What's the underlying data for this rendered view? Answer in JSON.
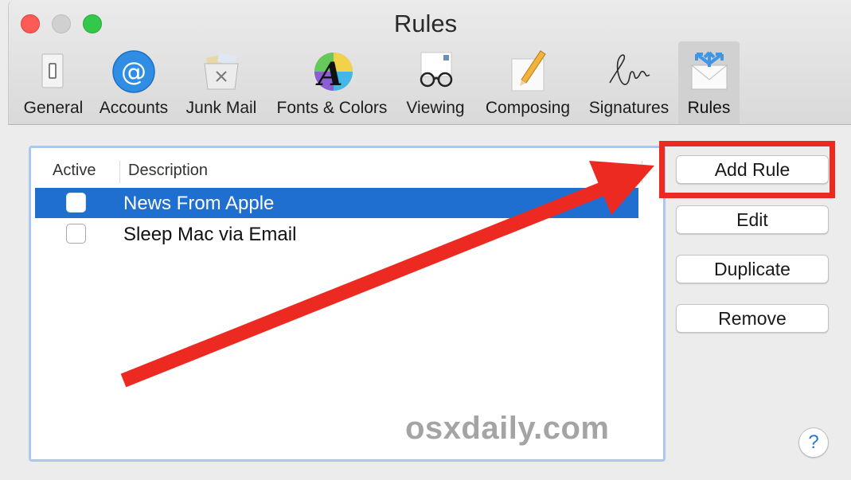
{
  "window": {
    "title": "Rules"
  },
  "toolbar": {
    "tabs": [
      {
        "label": "General",
        "icon": "general-switch-icon"
      },
      {
        "label": "Accounts",
        "icon": "at-sign-icon"
      },
      {
        "label": "Junk Mail",
        "icon": "junk-trash-icon"
      },
      {
        "label": "Fonts & Colors",
        "icon": "font-color-wheel-icon"
      },
      {
        "label": "Viewing",
        "icon": "glasses-envelope-icon"
      },
      {
        "label": "Composing",
        "icon": "pencil-paper-icon"
      },
      {
        "label": "Signatures",
        "icon": "signature-icon"
      },
      {
        "label": "Rules",
        "icon": "rules-envelope-arrows-icon"
      }
    ],
    "selected_tab": "Rules"
  },
  "rules_list": {
    "columns": {
      "active": "Active",
      "description": "Description"
    },
    "rows": [
      {
        "active": false,
        "description": "News From Apple",
        "selected": true
      },
      {
        "active": false,
        "description": "Sleep Mac via Email",
        "selected": false
      }
    ]
  },
  "buttons": {
    "add_rule": "Add Rule",
    "edit": "Edit",
    "duplicate": "Duplicate",
    "remove": "Remove",
    "help": "?"
  },
  "watermark": "osxdaily.com",
  "colors": {
    "selection": "#1f6fd1",
    "annotation_red": "#ec2a21",
    "list_focus_ring": "#a9c8ef"
  }
}
